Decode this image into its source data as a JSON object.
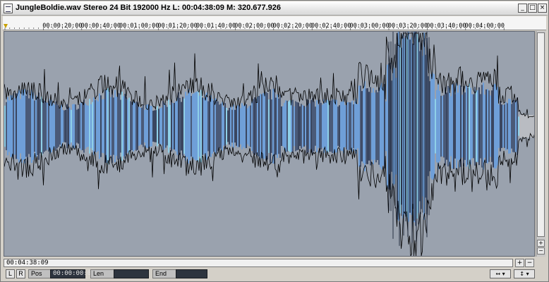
{
  "window": {
    "title": "JungleBoldie.wav  Stereo 24 Bit 192000 Hz L: 00:04:38:09 M: 320.677.926",
    "buttons": {
      "minimize": "_",
      "maximize": "□",
      "close": "×"
    }
  },
  "ruler": {
    "labels": [
      "00:00:20:00",
      "00:00:40:00",
      "00:01:00:00",
      "00:01:20:00",
      "00:01:40:00",
      "00:02:00:00",
      "00:02:20:00",
      "00:02:40:00",
      "00:03:00:00",
      "00:03:20:00",
      "00:03:40:00",
      "00:04:00:00"
    ]
  },
  "scroll": {
    "position_text": "00:04:38:09",
    "zoom_in": "+",
    "zoom_out": "−"
  },
  "vscroll": {
    "plus": "+",
    "minus": "−"
  },
  "status": {
    "left_button": "L",
    "right_button": "R",
    "pos_label": "Pos",
    "pos_value": "00:00:00:00",
    "len_label": "Len",
    "len_value": "",
    "end_label": "End",
    "end_value": "",
    "horiz_arrows": "↔ ▾",
    "vert_arrows": "↕ ▾"
  },
  "colors": {
    "wave_background": "#9aa2ae",
    "wave_fill_dark": "#4a5a78",
    "wave_fill_blue": "#6f9fd8",
    "wave_highlight": "#8fd0e8",
    "wave_outline": "#000000"
  }
}
